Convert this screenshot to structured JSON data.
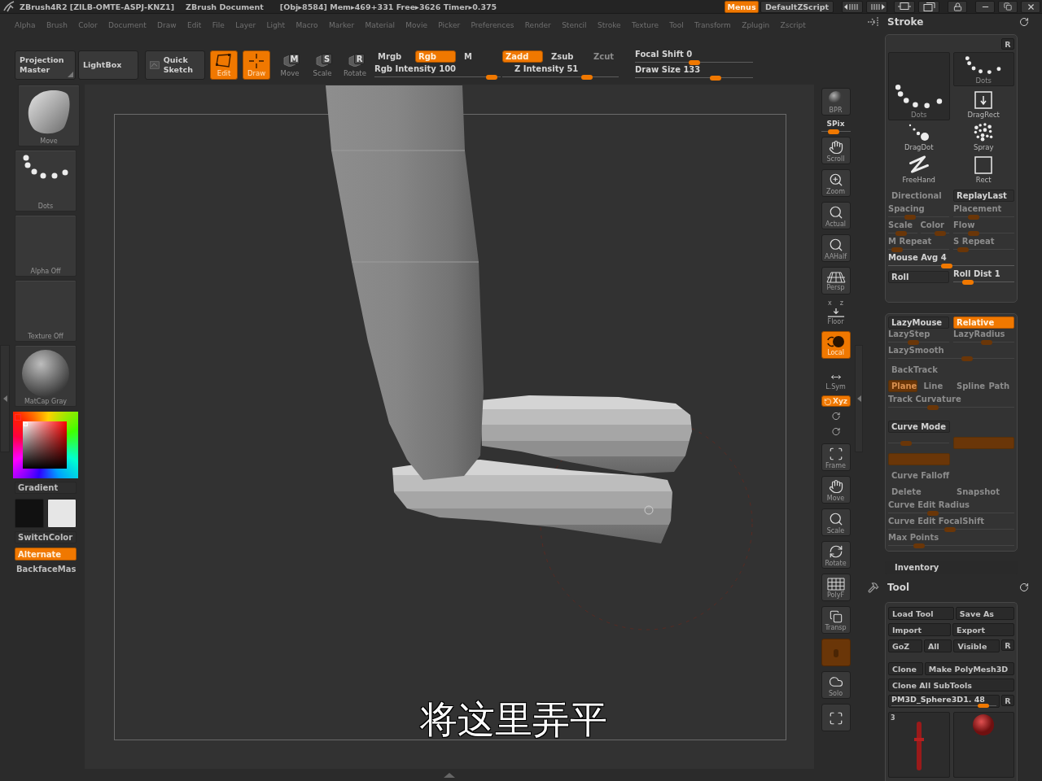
{
  "title_bar": {
    "app_title": "ZBrush4R2 [ZILB-OMTE-ASPJ-KNZ1]",
    "document": "ZBrush Document",
    "stats": "[Obj▸8584] Mem▸469+331 Free▸3626 Timer▸0.375",
    "buttons": [
      {
        "label": "Menus",
        "selected": true
      },
      {
        "label": "DefaultZScript",
        "selected": false
      }
    ]
  },
  "menu_bar": [
    "Alpha",
    "Brush",
    "Color",
    "Document",
    "Draw",
    "Edit",
    "File",
    "Layer",
    "Light",
    "Macro",
    "Marker",
    "Material",
    "Movie",
    "Picker",
    "Preferences",
    "Render",
    "Stencil",
    "Stroke",
    "Texture",
    "Tool",
    "Transform",
    "Zplugin",
    "Zscript"
  ],
  "top_shelf": {
    "buttons": [
      {
        "label": "Projection Master",
        "kind": "corner"
      },
      {
        "label": "LightBox",
        "kind": "plain"
      },
      {
        "label": "Quick Sketch",
        "kind": "sketch"
      }
    ],
    "modes": [
      {
        "label": "Edit",
        "kind": "edit",
        "selected": true
      },
      {
        "label": "Draw",
        "kind": "draw",
        "selected": true
      },
      {
        "label": "Move",
        "kind": "letter",
        "glyph": "M",
        "selected": false
      },
      {
        "label": "Scale",
        "kind": "letter",
        "glyph": "S",
        "selected": false
      },
      {
        "label": "Rotate",
        "kind": "letter",
        "glyph": "R",
        "selected": false
      }
    ],
    "color_modes": [
      {
        "label": "Mrgb",
        "selected": false
      },
      {
        "label": "Rgb",
        "selected": true
      },
      {
        "label": "M",
        "selected": false
      }
    ],
    "rgb_intensity": {
      "label": "Rgb Intensity 100",
      "level": 0.97
    },
    "z_modes": [
      {
        "label": "Zadd",
        "selected": true,
        "disabled": false
      },
      {
        "label": "Zsub",
        "selected": false,
        "disabled": false
      },
      {
        "label": "Zcut",
        "selected": false,
        "disabled": true
      }
    ],
    "z_intensity": {
      "label": "Z Intensity 51",
      "level": 0.75
    },
    "focal_shift": {
      "label": "Focal Shift 0",
      "level": 0.5
    },
    "draw_size": {
      "label": "Draw Size 133",
      "level": 0.7
    }
  },
  "left_shelf": {
    "tiles": [
      {
        "label": "Move",
        "kind": "brush"
      },
      {
        "label": "Dots",
        "kind": "stroke"
      },
      {
        "label": "Alpha Off",
        "kind": "alpha"
      },
      {
        "label": "Texture Off",
        "kind": "texture"
      },
      {
        "label": "MatCap Gray",
        "kind": "material"
      }
    ],
    "gradient": "Gradient",
    "swatches": [
      {
        "color": "#111111"
      },
      {
        "color": "#e6e6e6"
      }
    ],
    "switch_color": "SwitchColor",
    "alternate": {
      "label": "Alternate",
      "on": true
    },
    "backface": "BackfaceMas"
  },
  "viewport": {
    "subtitle": "将这里弄平"
  },
  "view_toolbar": [
    {
      "label": "BPR",
      "kind": "bpr",
      "selected": false,
      "disabled": false
    },
    {
      "label": "SPix",
      "kind": "spix",
      "selected": false,
      "disabled": false,
      "level": 0.4
    },
    {
      "label": "Scroll",
      "kind": "scroll",
      "selected": false,
      "disabled": false
    },
    {
      "label": "Zoom",
      "kind": "zoom",
      "selected": false,
      "disabled": false
    },
    {
      "label": "Actual",
      "kind": "actual",
      "selected": false,
      "disabled": false
    },
    {
      "label": "AAHalf",
      "kind": "aahalf",
      "selected": false,
      "disabled": false
    },
    {
      "label": "Persp",
      "kind": "persp",
      "selected": false,
      "disabled": false
    },
    {
      "label": "Floor",
      "kind": "floor",
      "selected": false,
      "disabled": false,
      "axes": [
        "x",
        "z"
      ]
    },
    {
      "label": "Local",
      "kind": "local",
      "selected": true,
      "disabled": false
    },
    {
      "label": "L.Sym",
      "kind": "lsym",
      "selected": false,
      "disabled": false
    },
    {
      "label": "Xyz",
      "kind": "xyz",
      "selected": true,
      "disabled": false
    },
    {
      "kind": "rot_y",
      "selected": false,
      "disabled": false
    },
    {
      "kind": "rot_z",
      "selected": false,
      "disabled": false
    },
    {
      "label": "Frame",
      "kind": "frame",
      "selected": false,
      "disabled": false
    },
    {
      "label": "Move",
      "kind": "move",
      "selected": false,
      "disabled": false
    },
    {
      "label": "Scale",
      "kind": "scale",
      "selected": false,
      "disabled": false
    },
    {
      "label": "Rotate",
      "kind": "rotate",
      "selected": false,
      "disabled": false
    },
    {
      "label": "PolyF",
      "kind": "polyf",
      "selected": false,
      "disabled": false
    },
    {
      "label": "Transp",
      "kind": "transp",
      "selected": false,
      "disabled": false
    },
    {
      "kind": "ghost",
      "selected": true,
      "disabled": true
    },
    {
      "label": "Solo",
      "kind": "solo",
      "selected": false,
      "disabled": false
    },
    {
      "kind": "xpose",
      "selected": false,
      "disabled": false
    }
  ],
  "stroke_palette": {
    "title": "Stroke",
    "r_button": "R",
    "current": {
      "label": "Dots"
    },
    "strokes": [
      {
        "label": "Dots",
        "kind": "dots",
        "selected": true
      },
      {
        "label": "DragRect",
        "kind": "dragrect",
        "selected": false
      },
      {
        "label": "DragDot",
        "kind": "dragdot",
        "selected": false
      },
      {
        "label": "Spray",
        "kind": "spray",
        "selected": false
      },
      {
        "label": "FreeHand",
        "kind": "freehand",
        "selected": false
      },
      {
        "label": "Rect",
        "kind": "rect",
        "selected": false
      }
    ],
    "rows": [
      [
        [
          {
            "label": "Directional",
            "kind": "button",
            "selected": false,
            "disabled": true
          }
        ],
        [
          {
            "label": "ReplayLast",
            "kind": "button",
            "selected": false,
            "disabled": false
          }
        ]
      ],
      [
        [
          {
            "label": "Spacing",
            "kind": "slider",
            "level": 0.32,
            "disabled": true
          }
        ],
        [
          {
            "label": "Placement",
            "kind": "slider",
            "level": 0.29,
            "disabled": true
          }
        ]
      ],
      [
        [
          {
            "label": "Scale",
            "kind": "slider",
            "level": 0.42,
            "disabled": true
          },
          {
            "label": "Color",
            "kind": "slider",
            "level": 0.8,
            "disabled": true
          }
        ],
        [
          {
            "label": "Flow",
            "kind": "slider",
            "level": 0.29,
            "disabled": true
          }
        ]
      ],
      [
        [
          {
            "label": "M Repeat",
            "kind": "slider",
            "level": 0.07,
            "disabled": true
          }
        ],
        [
          {
            "label": "S Repeat",
            "kind": "slider",
            "level": 0.08,
            "disabled": true
          }
        ]
      ],
      [
        [
          {
            "label": "Mouse Avg 4",
            "kind": "slider",
            "level": 0.46,
            "disabled": false
          }
        ]
      ],
      [
        [
          {
            "label": "Roll",
            "kind": "button",
            "selected": false,
            "disabled": false
          }
        ],
        [
          {
            "label": "Roll Dist 1",
            "kind": "slider",
            "level": 0.18,
            "disabled": false
          }
        ]
      ]
    ]
  },
  "lazy_panel": {
    "lazymouse_rows": [
      [
        [
          {
            "label": "LazyMouse",
            "kind": "button",
            "selected": false,
            "disabled": false
          }
        ],
        [
          {
            "label": "Relative",
            "kind": "button",
            "selected": true,
            "disabled": false
          }
        ]
      ],
      [
        [
          {
            "label": "LazyStep",
            "kind": "slider",
            "level": 0.4,
            "disabled": true
          }
        ],
        [
          {
            "label": "LazyRadius",
            "kind": "slider",
            "level": 0.55,
            "disabled": true
          }
        ]
      ],
      [
        [
          {
            "label": "LazySmooth",
            "kind": "slider",
            "level": 0.64,
            "disabled": true
          }
        ]
      ],
      [
        [
          {
            "label": "BackTrack",
            "kind": "button",
            "selected": false,
            "disabled": true
          }
        ]
      ],
      [
        [
          {
            "label": "Plane",
            "kind": "button",
            "selected": true,
            "disabled": true
          },
          {
            "label": "Line",
            "kind": "button",
            "selected": false,
            "disabled": true
          }
        ],
        [
          {
            "label": "Spline",
            "kind": "button",
            "selected": false,
            "disabled": true
          },
          {
            "label": "Path",
            "kind": "button",
            "selected": false,
            "disabled": true
          }
        ]
      ],
      [
        [
          {
            "label": "Track Curvature",
            "kind": "slider",
            "level": 0.34,
            "disabled": true
          }
        ]
      ]
    ],
    "curve_rows": [
      [
        [
          {
            "label": "Curve Mode",
            "kind": "button",
            "selected": false,
            "disabled": false
          }
        ]
      ],
      [
        [
          {
            "kind": "slider",
            "level": 0.25,
            "disabled": true
          }
        ],
        [
          {
            "kind": "button",
            "selected": true,
            "disabled": true
          }
        ]
      ],
      [
        [
          {
            "kind": "button",
            "selected": true,
            "disabled": true
          }
        ]
      ],
      [
        [
          {
            "label": "Curve Falloff",
            "kind": "button",
            "selected": false,
            "disabled": true
          }
        ]
      ],
      [
        [
          {
            "label": "Delete",
            "kind": "button",
            "selected": false,
            "disabled": true
          }
        ],
        [
          {
            "label": "Snapshot",
            "kind": "button",
            "selected": false,
            "disabled": true
          }
        ]
      ],
      [
        [
          {
            "label": "Curve Edit Radius",
            "kind": "slider",
            "level": 0.34,
            "disabled": true
          }
        ]
      ],
      [
        [
          {
            "label": "Curve Edit FocalShift",
            "kind": "slider",
            "level": 0.49,
            "disabled": true
          }
        ]
      ],
      [
        [
          {
            "label": "Max Points",
            "kind": "slider",
            "level": 0.22,
            "disabled": true
          }
        ]
      ]
    ]
  },
  "inventory": "Inventory",
  "tool_palette": {
    "title": "Tool",
    "button_groups": [
      [
        [
          {
            "label": "Load Tool",
            "kind": "button"
          },
          {
            "label": "Save As",
            "kind": "button"
          }
        ],
        [
          {
            "label": "Import",
            "kind": "button"
          },
          {
            "label": "Export",
            "kind": "button"
          }
        ],
        [
          {
            "label": "GoZ",
            "kind": "button"
          },
          {
            "label": "All",
            "kind": "button"
          },
          {
            "label": "Visible",
            "kind": "button"
          },
          {
            "label": "R",
            "kind": "small"
          }
        ]
      ],
      [
        [
          {
            "label": "Clone",
            "kind": "button"
          },
          {
            "label": "Make PolyMesh3D",
            "kind": "button"
          }
        ],
        [
          {
            "label": "Clone All SubTools",
            "kind": "button"
          }
        ],
        [
          {
            "label": "PM3D_Sphere3D1. 48",
            "kind": "slider",
            "level": 0.92
          },
          {
            "label": "R",
            "kind": "small"
          }
        ]
      ]
    ],
    "thumbnails": [
      {
        "label": "3",
        "kind": "figure"
      },
      {
        "kind": "ball"
      }
    ]
  }
}
